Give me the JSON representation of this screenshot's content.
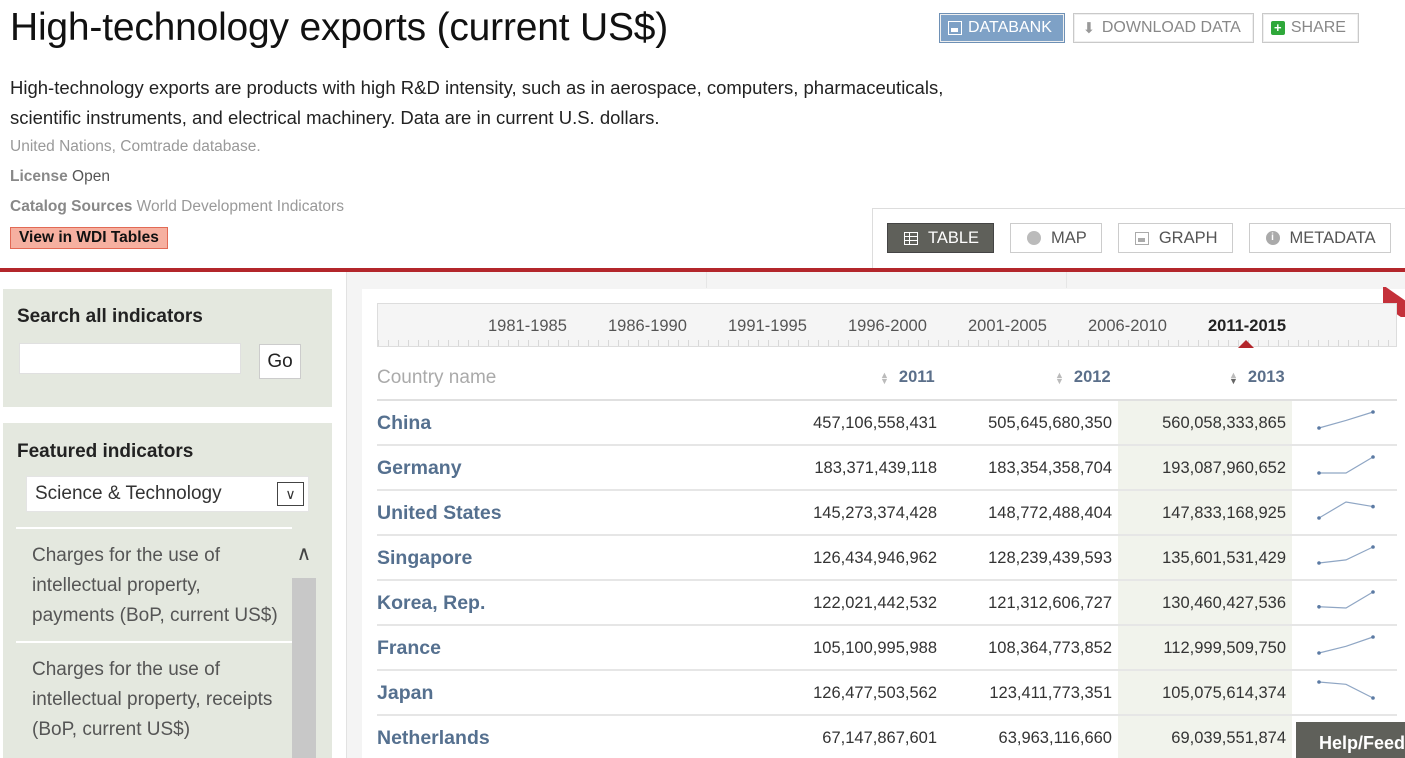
{
  "header": {
    "title": "High-technology exports (current US$)",
    "actions": {
      "databank": "DATABANK",
      "download": "DOWNLOAD DATA",
      "share": "SHARE"
    },
    "description": "High-technology exports are products with high R&D intensity, such as in aerospace, computers, pharmaceuticals, scientific instruments, and electrical machinery. Data are in current U.S. dollars.",
    "source": "United Nations, Comtrade database.",
    "license_label": "License",
    "license_value": "Open",
    "catalog_label": "Catalog Sources",
    "catalog_value": "World Development Indicators",
    "wdi_button": "View in WDI Tables"
  },
  "view_tabs": [
    "TABLE",
    "MAP",
    "GRAPH",
    "METADATA"
  ],
  "sidebar": {
    "search_title": "Search all indicators",
    "search_value": "",
    "go_label": "Go",
    "featured_title": "Featured indicators",
    "featured_selected": "Science & Technology",
    "featured_items": [
      "Charges for the use of intellectual property, payments (BoP, current US$)",
      "Charges for the use of intellectual property, receipts (BoP, current US$)"
    ]
  },
  "periods": [
    "1981-1985",
    "1986-1990",
    "1991-1995",
    "1996-2000",
    "2001-2005",
    "2006-2010",
    "2011-2015"
  ],
  "active_period": "2011-2015",
  "table": {
    "country_header": "Country name",
    "years": [
      "2011",
      "2012",
      "2013"
    ],
    "rows": [
      {
        "country": "China",
        "values": [
          "457,106,558,431",
          "505,645,680,350",
          "560,058,333,865"
        ],
        "trend": [
          457.1,
          505.6,
          560.1
        ]
      },
      {
        "country": "Germany",
        "values": [
          "183,371,439,118",
          "183,354,358,704",
          "193,087,960,652"
        ],
        "trend": [
          183.4,
          183.4,
          193.1
        ]
      },
      {
        "country": "United States",
        "values": [
          "145,273,374,428",
          "148,772,488,404",
          "147,833,168,925"
        ],
        "trend": [
          145.3,
          148.8,
          147.8
        ]
      },
      {
        "country": "Singapore",
        "values": [
          "126,434,946,962",
          "128,239,439,593",
          "135,601,531,429"
        ],
        "trend": [
          126.4,
          128.2,
          135.6
        ]
      },
      {
        "country": "Korea, Rep.",
        "values": [
          "122,021,442,532",
          "121,312,606,727",
          "130,460,427,536"
        ],
        "trend": [
          122.0,
          121.3,
          130.5
        ]
      },
      {
        "country": "France",
        "values": [
          "105,100,995,988",
          "108,364,773,852",
          "112,999,509,750"
        ],
        "trend": [
          105.1,
          108.4,
          113.0
        ]
      },
      {
        "country": "Japan",
        "values": [
          "126,477,503,562",
          "123,411,773,351",
          "105,075,614,374"
        ],
        "trend": [
          126.5,
          123.4,
          105.1
        ]
      },
      {
        "country": "Netherlands",
        "values": [
          "67,147,867,601",
          "63,963,116,660",
          "69,039,551,874"
        ],
        "trend": []
      }
    ]
  },
  "help_tab": "Help/Feed",
  "colors": {
    "accent_red": "#b3262b",
    "link_blue": "#55708f",
    "databank_blue": "#7ea1c6"
  }
}
